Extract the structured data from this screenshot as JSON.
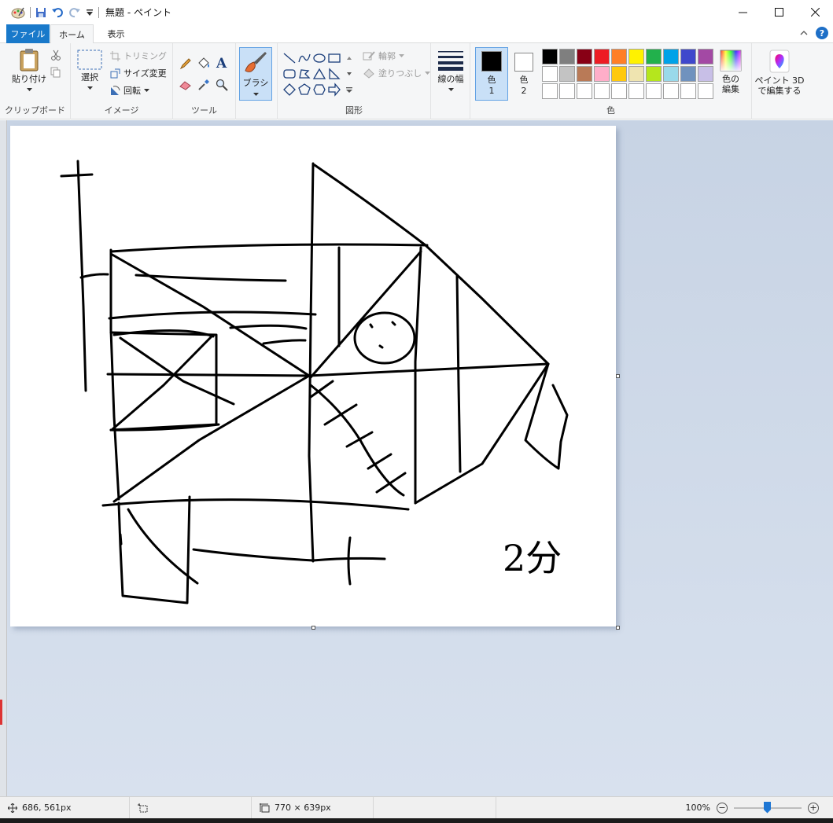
{
  "window": {
    "title": "無題 - ペイント",
    "controls": [
      "minimize",
      "maximize",
      "close"
    ]
  },
  "tabs": {
    "file": "ファイル",
    "home": "ホーム",
    "view": "表示",
    "active": "ホーム"
  },
  "ribbon": {
    "clipboard": {
      "paste": "貼り付け",
      "label": "クリップボード"
    },
    "image": {
      "select": "選択",
      "crop": "トリミング",
      "resize": "サイズ変更",
      "rotate": "回転",
      "label": "イメージ"
    },
    "tools": {
      "label": "ツール"
    },
    "brush": {
      "label": "ブラシ"
    },
    "shapes": {
      "outline": "輪郭",
      "fill": "塗りつぶし",
      "label": "図形"
    },
    "size": {
      "label": "線の幅"
    },
    "color1": {
      "label1": "色",
      "label2": "1",
      "value": "#000000"
    },
    "color2": {
      "label1": "色",
      "label2": "2",
      "value": "#ffffff"
    },
    "colors": {
      "label": "色",
      "row1": [
        "#000000",
        "#7f7f7f",
        "#880015",
        "#ed1c24",
        "#ff7f27",
        "#fff200",
        "#22b14c",
        "#00a2e8",
        "#3f48cc",
        "#a349a4"
      ],
      "row2": [
        "#ffffff",
        "#c3c3c3",
        "#b97a57",
        "#ffaec9",
        "#ffc90e",
        "#efe4b0",
        "#b5e61d",
        "#99d9ea",
        "#7092be",
        "#c8bfe7"
      ],
      "row3": [
        "#ffffff",
        "#ffffff",
        "#ffffff",
        "#ffffff",
        "#ffffff",
        "#ffffff",
        "#ffffff",
        "#ffffff",
        "#ffffff",
        "#ffffff"
      ]
    },
    "edit_colors": {
      "line1": "色の",
      "line2": "編集"
    },
    "paint3d": {
      "line1": "ペイント 3D",
      "line2": "で編集する"
    }
  },
  "canvas": {
    "handwritten_text": "2分"
  },
  "status": {
    "cursor_pos": "686, 561px",
    "selection_size": "",
    "image_size": "770 × 639px",
    "zoom": "100%"
  }
}
